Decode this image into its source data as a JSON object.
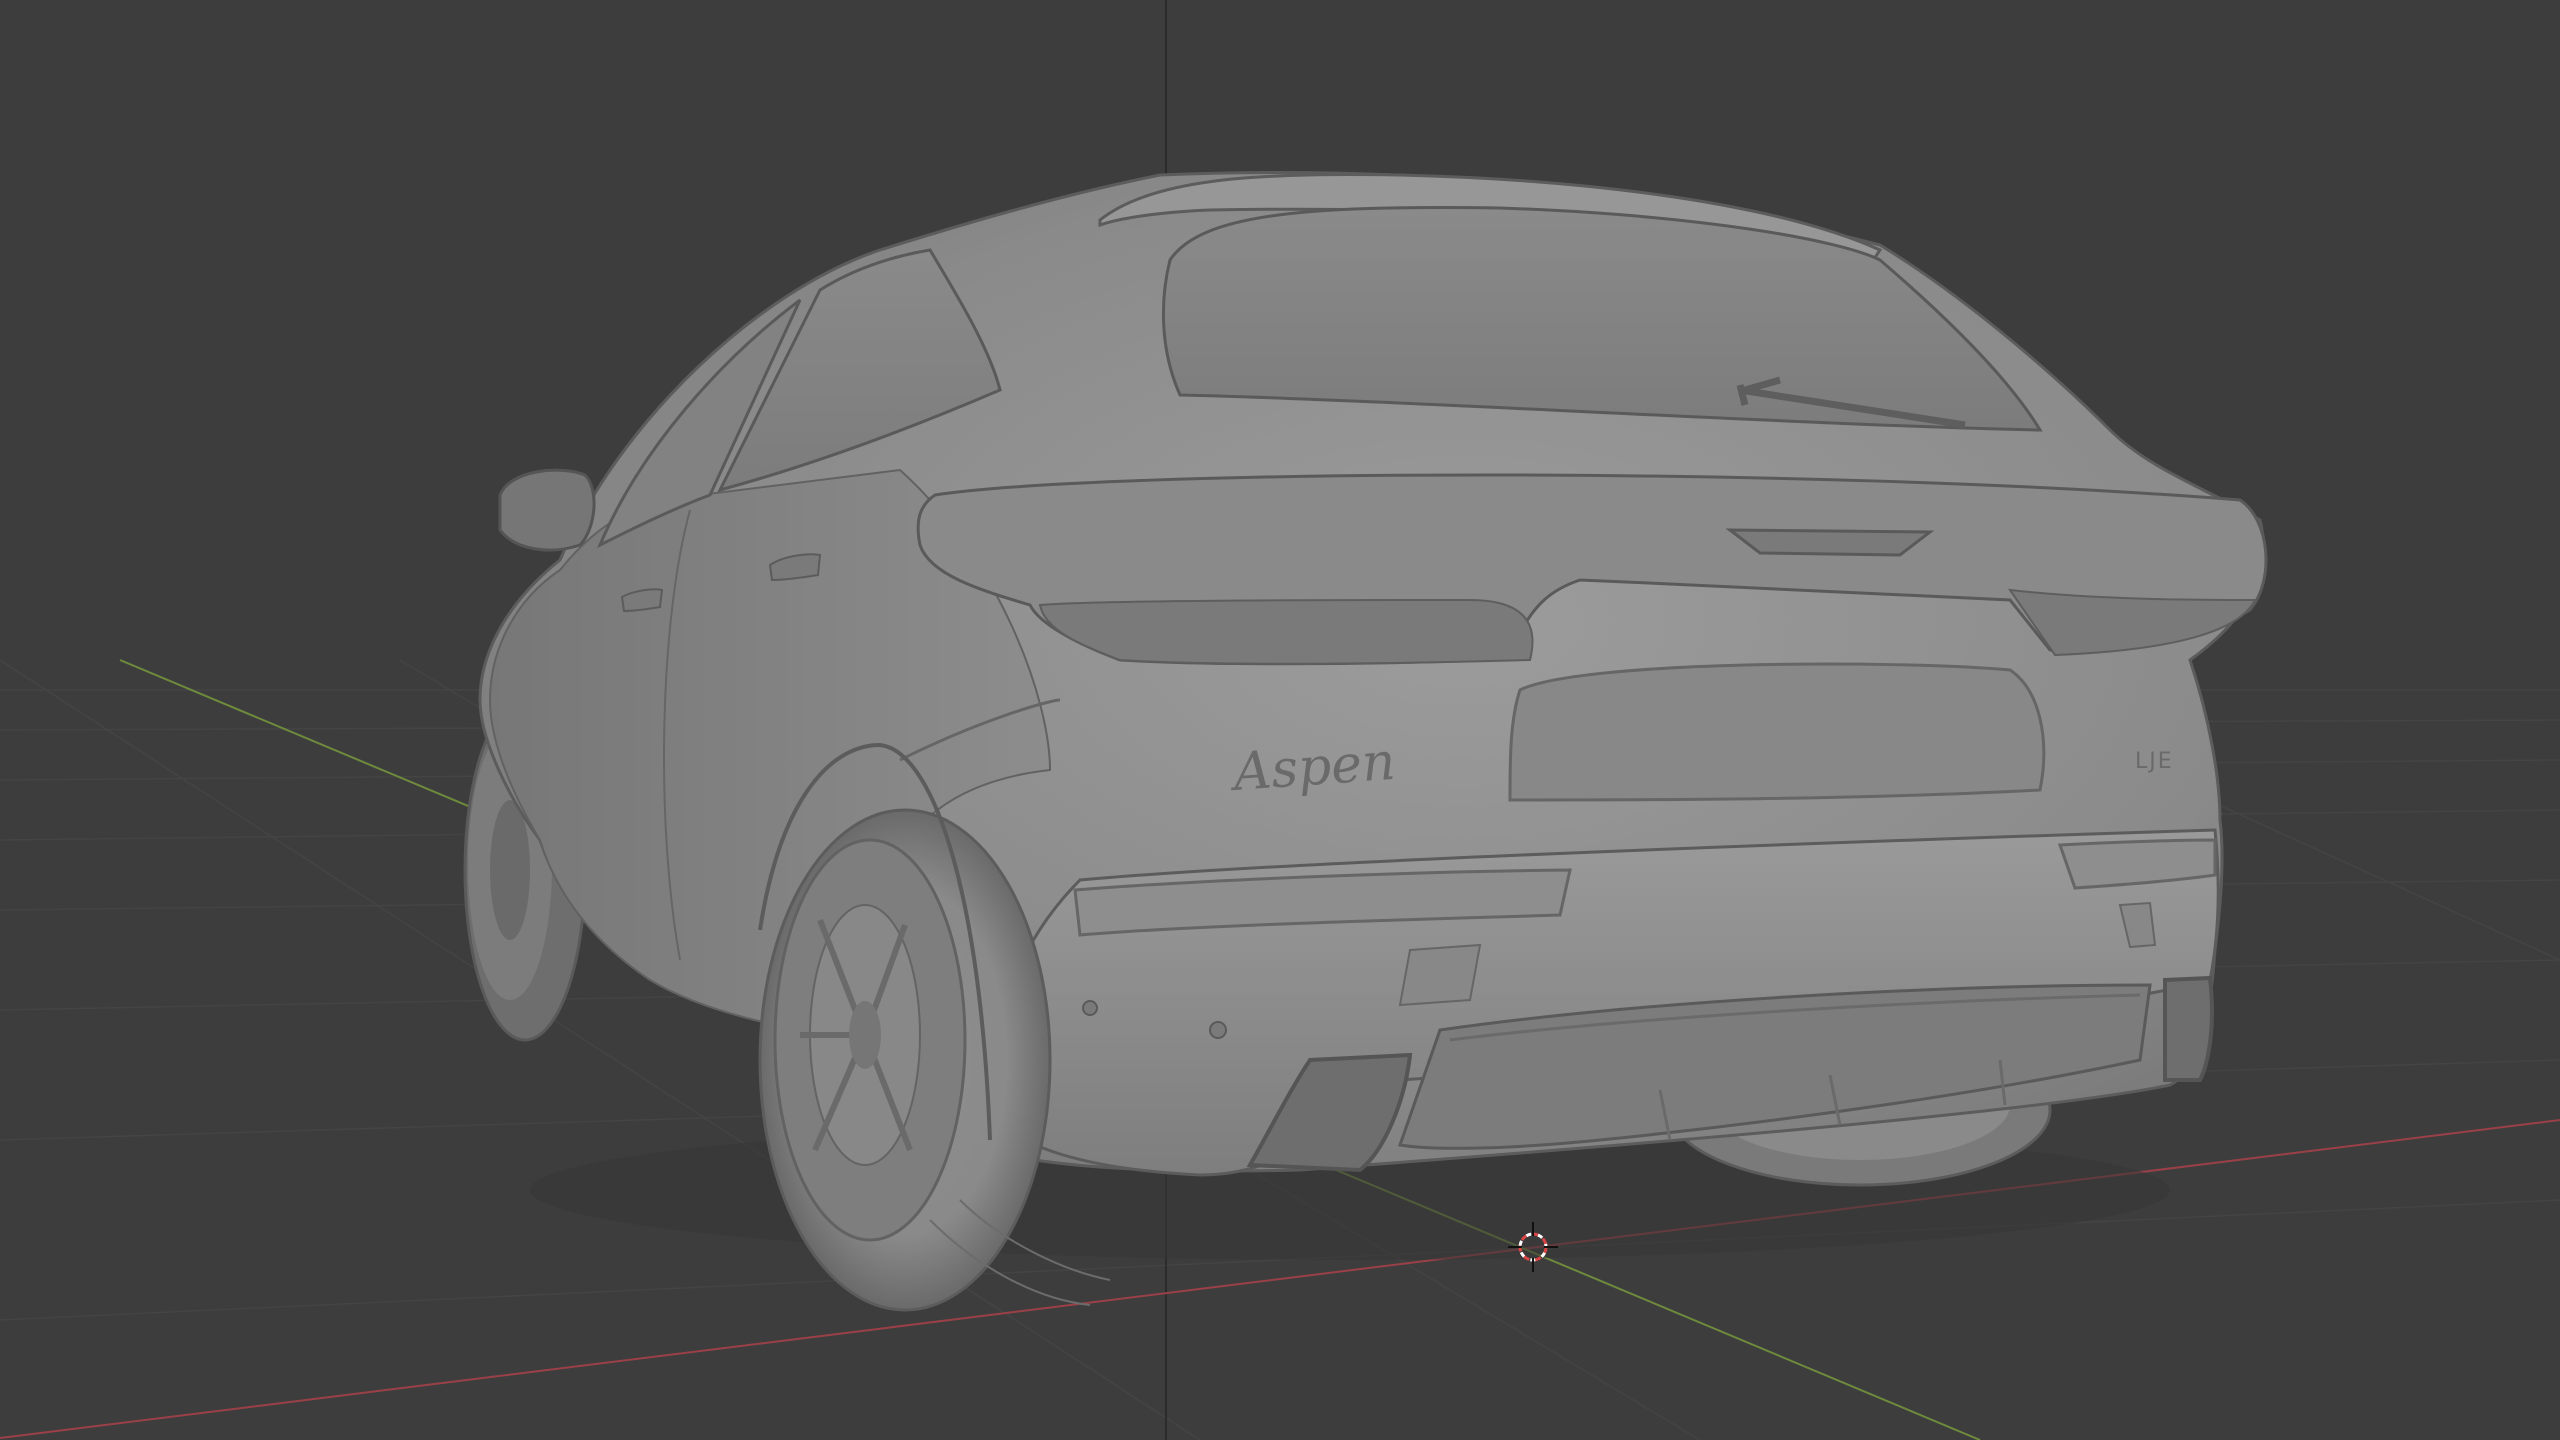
{
  "viewport": {
    "shading": "solid",
    "background_color": "#3d3d3d",
    "floor_grid": true,
    "axis_x_color": "#9a4048",
    "axis_y_color": "#6e8a3c",
    "model_color": "#8c8c8c"
  },
  "scene": {
    "object": "car-model",
    "badge_text": "Aspen",
    "trim_badge": "LJE"
  },
  "cursor": {
    "kind": "3d-cursor-icon",
    "ring_colors": [
      "#d94444",
      "#ffffff"
    ]
  }
}
